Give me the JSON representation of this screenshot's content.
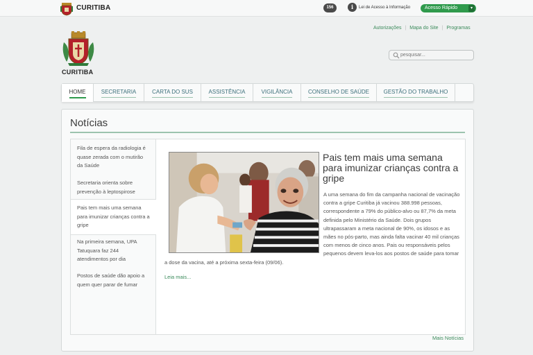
{
  "topbar": {
    "city": "CURITIBA",
    "badge": "156",
    "info_icon": "info-icon",
    "lei_link": "Lei de Acesso à Informação",
    "acesso_rapido": "Acesso Rápido",
    "acesso_arrow": "▾"
  },
  "header": {
    "links": [
      "Autorizações",
      "Mapa do Site",
      "Programas"
    ],
    "city": "CURITIBA",
    "search_placeholder": "pesquisar..."
  },
  "nav": {
    "items": [
      "HOME",
      "SECRETARIA",
      "CARTA DO SUS",
      "ASSISTÊNCIA",
      "VIGILÂNCIA",
      "CONSELHO DE SAÚDE",
      "GESTÃO DO TRABALHO"
    ],
    "active_index": 0
  },
  "news": {
    "title": "Notícias",
    "items": [
      "Fila de espera da radiologia é quase zerada com o mutirão da Saúde",
      "Secretaria orienta sobre prevenção à leptospirose",
      "Pais tem mais uma semana para imunizar crianças contra a gripe",
      "Na primeira semana, UPA Tatuquara faz 244 atendimentos por dia",
      "Postos de saúde dão apoio a quem quer parar de fumar"
    ],
    "active_index": 2,
    "feature": {
      "title": "Pais tem mais uma semana para imunizar crianças contra a gripe",
      "body": "A uma semana do fim da campanha nacional de vacinação contra a gripe Curitiba já vacinou 388.998 pessoas, correspondente a 79% do público-alvo ou 87,7% da meta definida pelo Ministério da Saúde. Dois grupos ultrapassaram a meta nacional de 90%, os idosos e as mães no pós-parto, mas ainda falta vacinar 40 mil crianças com menos de cinco anos. Pais ou responsáveis pelos pequenos devem leva-los aos postos de saúde para tomar a dose da vacina, até a próxima sexta-feira (09/06).",
      "read_more": "Leia mais..."
    },
    "more_link": "Mais Notícias"
  },
  "colors": {
    "accent_green": "#2f9a4c",
    "link_green": "#3a8a5a",
    "nav_text": "#3b6e7a",
    "background": "#eef0f0"
  }
}
